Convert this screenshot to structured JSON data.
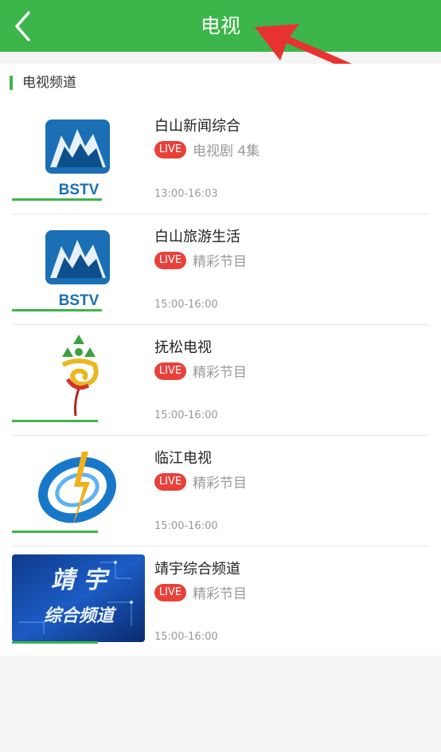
{
  "header": {
    "title": "电视",
    "accent_color": "#3cb54a",
    "back_icon": "chevron-left-icon",
    "annotation_arrow_color": "#e8322f"
  },
  "section": {
    "label": "电视频道"
  },
  "live_badge_color": "#e8413a",
  "channels": [
    {
      "name": "白山新闻综合",
      "live_label": "LIVE",
      "program": "电视剧 4集",
      "time": "13:00-16:03",
      "logo": "BSTV",
      "logo_icon": "bstv-mountain-logo"
    },
    {
      "name": "白山旅游生活",
      "live_label": "LIVE",
      "program": "精彩节目",
      "time": "15:00-16:00",
      "logo": "BSTV",
      "logo_icon": "bstv-mountain-logo"
    },
    {
      "name": "抚松电视",
      "live_label": "LIVE",
      "program": "精彩节目",
      "time": "15:00-16:00",
      "logo_icon": "fusong-emblem-logo"
    },
    {
      "name": "临江电视",
      "live_label": "LIVE",
      "program": "精彩节目",
      "time": "15:00-16:00",
      "logo_icon": "linjiang-ring-logo"
    },
    {
      "name": "靖宇综合频道",
      "live_label": "LIVE",
      "program": "精彩节目",
      "time": "15:00-16:00",
      "logo_line1": "靖 宇",
      "logo_line2": "综合频道",
      "logo_icon": "jingyu-banner-logo"
    }
  ]
}
